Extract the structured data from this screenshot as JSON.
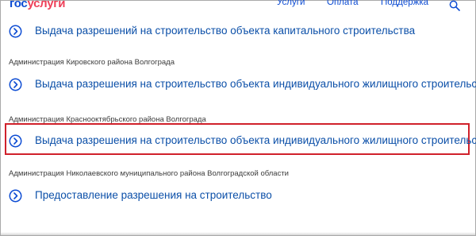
{
  "header": {
    "logo": {
      "part_a": "гос",
      "part_b": "услуги"
    },
    "nav": [
      "Услуги",
      "Оплата",
      "Поддержка"
    ],
    "search_icon": "search-icon"
  },
  "services": [
    {
      "title": "Выдача разрешений на строительство объекта капитального строительства"
    },
    {
      "organization": "Администрация Кировского района Волгограда",
      "title": "Выдача разрешения на строительство объекта индивидуального жилищного строительства"
    },
    {
      "organization": "Администрация Краснооктябрьского района Волгограда",
      "title": "Выдача разрешения на строительство объекта индивидуального жилищного строительства",
      "highlighted": true
    },
    {
      "organization": "Администрация Николаевского муниципального района Волгоградской области",
      "title": "Предоставление разрешения на строительство"
    }
  ],
  "colors": {
    "accent": "#0d4cd3",
    "logo_red": "#ee3f58",
    "link": "#0b4fa8",
    "highlight_border": "#d0212b"
  },
  "icons": {
    "row_chevron": "chevron-right-circle-icon"
  }
}
